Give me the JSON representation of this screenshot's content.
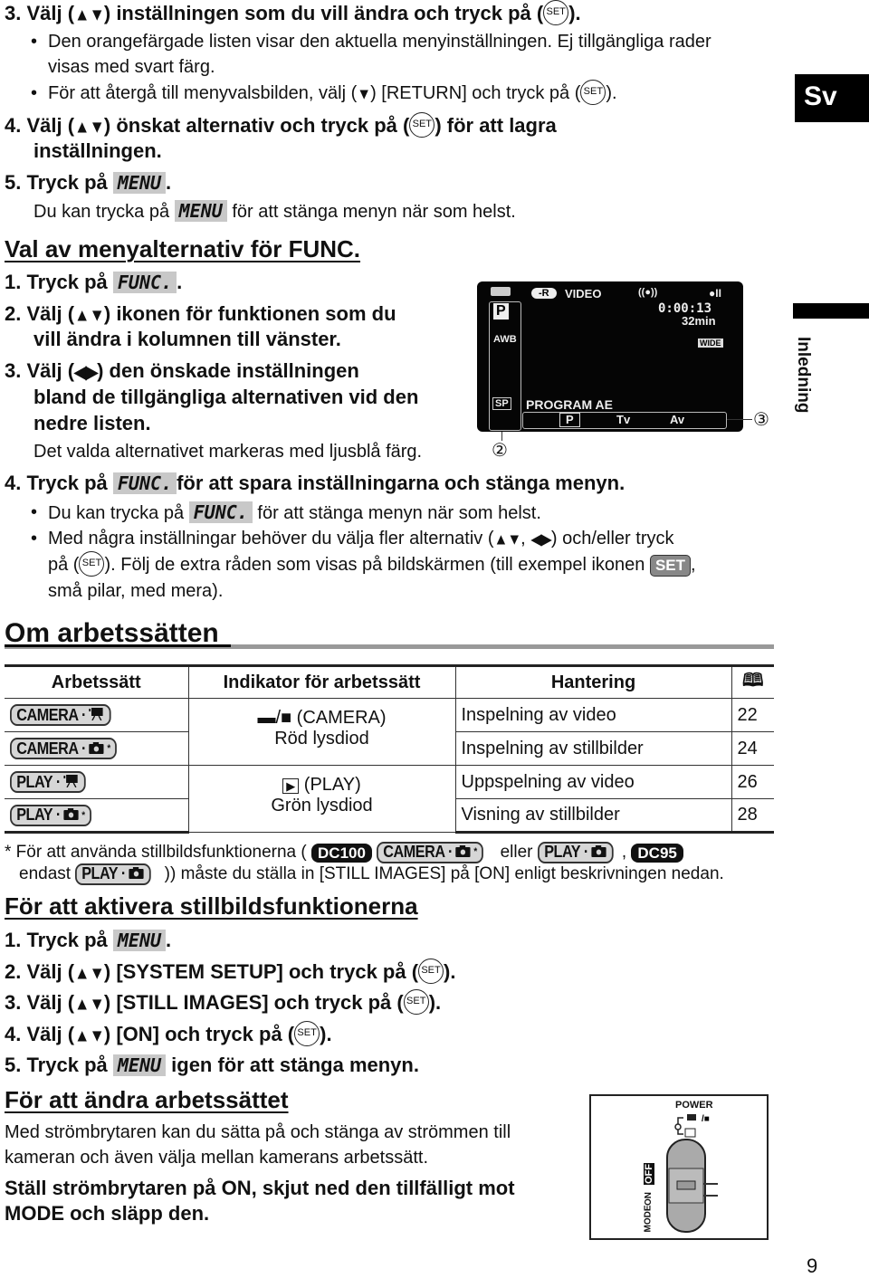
{
  "side_tab": {
    "language": "Sv",
    "section": "Inledning"
  },
  "top": {
    "l1": [
      "3. Välj (",
      {
        "icon": "up-down-arrows",
        "text": "▲▼"
      },
      ") inställningen som du vill ändra och tryck på (",
      {
        "icon": "set-button",
        "text": "SET"
      },
      ")."
    ],
    "l2": [
      "Den orangefärgade listen visar den aktuella menyinställningen. Ej tillgängliga rader"
    ],
    "l3": [
      "visas med svart färg."
    ],
    "l4": [
      "För att återgå till menyvalsbilden, välj (",
      {
        "icon": "down-arrow",
        "text": "▼"
      },
      ") [RETURN] och tryck på (",
      {
        "icon": "set-button",
        "text": "SET"
      },
      ")."
    ],
    "l5": [
      "4. Välj (",
      {
        "icon": "up-down-arrows",
        "text": "▲▼"
      },
      ") önskat alternativ och tryck på (",
      {
        "icon": "set-button",
        "text": "SET"
      },
      ") för att lagra"
    ],
    "l6": [
      "inställningen."
    ],
    "l7": [
      "5. Tryck på ",
      {
        "key": "MENU"
      },
      "."
    ],
    "l8": [
      "Du kan trycka på ",
      {
        "key": "MENU"
      },
      " för att stänga menyn när som helst."
    ]
  },
  "func": {
    "heading": "Val av menyalternativ för FUNC.",
    "l1": [
      "1. Tryck på ",
      {
        "key": "FUNC."
      },
      "."
    ],
    "l2": [
      "2. Välj (",
      {
        "icon": "up-down-arrows",
        "text": "▲▼"
      },
      ") ikonen för funktionen som du"
    ],
    "l3": [
      "vill ändra i kolumnen till vänster."
    ],
    "l4": [
      "3. Välj (",
      {
        "icon": "left-right-arrows",
        "text": "◀▶"
      },
      ") den önskade inställningen"
    ],
    "l5": [
      "bland de tillgängliga alternativen vid den"
    ],
    "l6": [
      "nedre listen."
    ],
    "l7": [
      "Det valda alternativet markeras med ljusblå färg."
    ],
    "l8": [
      "4. Tryck på ",
      {
        "key": "FUNC."
      },
      "för att spara inställningarna och stänga menyn."
    ],
    "l9": [
      "Du kan trycka på ",
      {
        "key": "FUNC."
      },
      " för att stänga menyn när som helst."
    ],
    "l10": [
      "Med några inställningar behöver du välja fler alternativ (",
      {
        "icon": "up-down-arrows",
        "text": "▲▼"
      },
      ", ",
      {
        "icon": "left-right-arrows",
        "text": "◀▶"
      },
      ") och/eller tryck"
    ],
    "l11": [
      "på (",
      {
        "icon": "set-button",
        "text": "SET"
      },
      "). Följ de extra råden som visas på bildskärmen (till exempel ikonen ",
      {
        "seticon": "SET"
      },
      ","
    ],
    "l12": [
      "små pilar, med mera)."
    ]
  },
  "camera_screen": {
    "disc": "-R",
    "video": "VIDEO",
    "stabilizer": "((●))",
    "rec": "●II",
    "time": "0:00:13",
    "remaining": "32min",
    "wide": "WIDE",
    "mode_p": "P",
    "awb": "AWB",
    "sp": "SP",
    "program": "PROGRAM  AE",
    "bar": [
      "P",
      "Tv",
      "Av"
    ],
    "callout_left": "②",
    "callout_right": "③"
  },
  "modes": {
    "heading": "Om arbetssätten",
    "headers": [
      "Arbetssätt",
      "Indikator för arbetssätt",
      "Hantering",
      "book-icon"
    ],
    "rows": [
      {
        "mode": "CAMERA",
        "kind": "movie",
        "star": "",
        "use": "Inspelning av video",
        "page": "22"
      },
      {
        "mode": "CAMERA",
        "kind": "photo",
        "star": "*",
        "use": "Inspelning av stillbilder",
        "page": "24"
      },
      {
        "mode": "PLAY",
        "kind": "movie",
        "star": "",
        "use": "Uppspelning av video",
        "page": "26"
      },
      {
        "mode": "PLAY",
        "kind": "photo",
        "star": "*",
        "use": "Visning av stillbilder",
        "page": "28"
      }
    ],
    "indicators": [
      {
        "label": "(CAMERA)",
        "led": "Röd lysdiod"
      },
      {
        "label": "(PLAY)",
        "led": "Grön lysdiod"
      }
    ],
    "foot1": [
      "* För att använda stillbildsfunktionerna ( ",
      {
        "badge": "DC100"
      },
      " ",
      {
        "mode": "CAMERA",
        "kind": "photo",
        "star": "*"
      },
      " eller ",
      {
        "mode": "PLAY",
        "kind": "photo",
        "star": ""
      },
      ", ",
      {
        "badge": "DC95"
      }
    ],
    "foot2": [
      "endast ",
      {
        "mode": "PLAY",
        "kind": "photo",
        "star": ""
      },
      " )) måste du ställa in [STILL IMAGES] på [ON] enligt beskrivningen nedan."
    ]
  },
  "still": {
    "heading": "För att aktivera stillbildsfunktionerna",
    "l1": [
      "1. Tryck på ",
      {
        "key": "MENU"
      },
      "."
    ],
    "l2": [
      "2. Välj (",
      {
        "icon": "up-down-arrows",
        "text": "▲▼"
      },
      ") [SYSTEM SETUP] och tryck på (",
      {
        "icon": "set-button",
        "text": "SET"
      },
      ")."
    ],
    "l3": [
      "3. Välj (",
      {
        "icon": "up-down-arrows",
        "text": "▲▼"
      },
      ") [STILL IMAGES] och tryck på (",
      {
        "icon": "set-button",
        "text": "SET"
      },
      ")."
    ],
    "l4": [
      "4. Välj (",
      {
        "icon": "up-down-arrows",
        "text": "▲▼"
      },
      ") [ON] och tryck på (",
      {
        "icon": "set-button",
        "text": "SET"
      },
      ")."
    ],
    "l5": [
      "5. Tryck på ",
      {
        "key": "MENU"
      },
      " igen för att stänga menyn."
    ]
  },
  "change": {
    "heading": "För att ändra arbetssättet",
    "l1": [
      "Med strömbrytaren kan du sätta på och stänga av strömmen till"
    ],
    "l2": [
      "kameran och även välja mellan kamerans arbetssätt."
    ],
    "l3": [
      "Ställ strömbrytaren på ON, skjut ned den tillfälligt mot"
    ],
    "l4": [
      "MODE och släpp den."
    ]
  },
  "power_switch": {
    "power": "POWER",
    "off": "OFF",
    "on": "ON",
    "mode": "MODE"
  },
  "page_number": "9"
}
